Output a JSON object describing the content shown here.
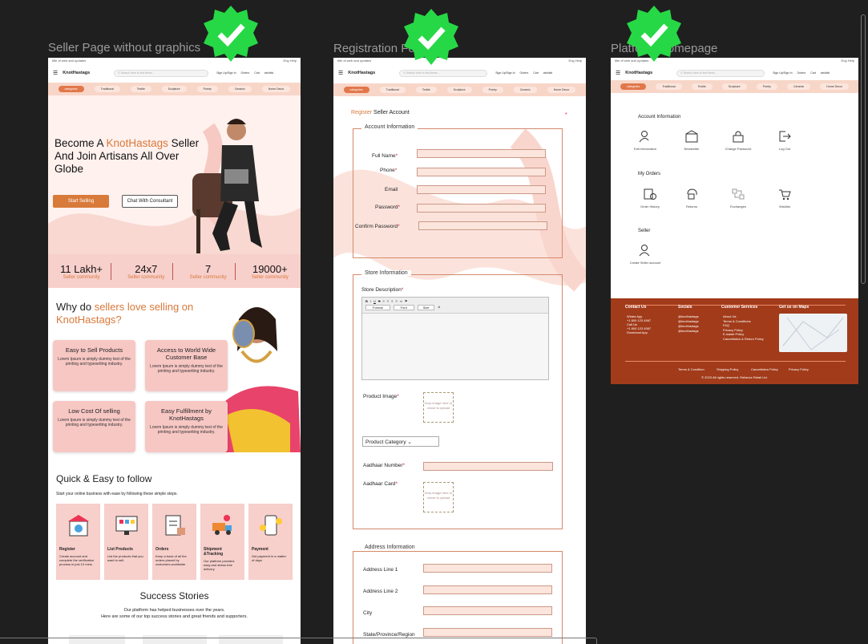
{
  "frames": {
    "seller": {
      "label": "Seller Page without graphics"
    },
    "registration": {
      "label": "Registration Form"
    },
    "platform": {
      "label": "Platform Homepage"
    }
  },
  "common": {
    "topbar_left": "title of web and updates",
    "topbar_right": "Eng  Help",
    "logo": "KnotHastags",
    "search_placeholder": "Search here to find items...",
    "links": [
      "Sign Up/Sign In",
      "Orders",
      "Cart",
      "wishlist"
    ],
    "categories": [
      "categories",
      "Traditional",
      "Textile",
      "Sculpture",
      "Poetry",
      "Ceramic",
      "Home Decor"
    ]
  },
  "seller": {
    "hero_line1_a": "Become A ",
    "hero_line1_b": "KnotHastags",
    "hero_line1_c": " Seller",
    "hero_line2": "And Join Artisans All Over",
    "hero_line3": "Globe",
    "start_btn": "Start Selling",
    "consult_btn": "Chat With Consultant",
    "stats": [
      {
        "n": "11 Lakh+",
        "l": "Seller community"
      },
      {
        "n": "24x7",
        "l": "Seller community"
      },
      {
        "n": "7",
        "l": "Seller community"
      },
      {
        "n": "19000+",
        "l": "Seller community"
      }
    ],
    "why_a": "Why  do ",
    "why_b": "sellers love selling on",
    "why_c": "KnotHastags?",
    "cards": [
      {
        "t": "Easy  to Sell Products",
        "d": "Lorem Ipsum is simply dummy text of the printing and typesetting industry."
      },
      {
        "t": "Access to World Wide Customer Base",
        "d": "Lorem Ipsum is simply dummy text of the printing and typesetting industry."
      },
      {
        "t": "Low Cost Of selling",
        "d": "Lorem Ipsum is simply dummy text of the printing and typesetting industry."
      },
      {
        "t": "Easy Fulfillment by KnotHastags",
        "d": "Lorem Ipsum is simply dummy text of the printing and typesetting industry."
      }
    ],
    "quick_title": "Quick & Easy to follow",
    "quick_sub": "Start your online business with ease by following these simple steps.",
    "steps": [
      {
        "t": "Register",
        "d": "Create account and complete the verification process in just 10 mins."
      },
      {
        "t": "List Products",
        "d": "List the products that you want to sell."
      },
      {
        "t": "Orders",
        "d": "Keep a track of all the orders placed by customers worldwide"
      },
      {
        "t": "Shipment &Tracking",
        "d": "Our platform provides easy and stress free delivery"
      },
      {
        "t": "Payment",
        "d": "Get payment in a matter of days"
      }
    ],
    "success_title": "Success Stories",
    "success_sub1": "Our platform has helped businesses over the years.",
    "success_sub2": "Here are some of our top success stories and great friends and supporters."
  },
  "registration": {
    "title_a": "Register",
    "title_b": " Seller Account",
    "account_legend": "Account Information",
    "fields": [
      "Full Name",
      "Phone",
      "Email",
      "Password",
      "Confirm Password"
    ],
    "store_legend": "Store Information",
    "store_desc": "Store Description",
    "rte_format": "Format",
    "rte_font": "Font",
    "rte_size": "Size",
    "product_image": "Product Image",
    "drop_text": "Drop image here or chose to upload",
    "product_category": "Product Category",
    "aadhaar_number": "Aadhaar Number",
    "aadhaar_card": "Aadhaar Card",
    "address_legend": "Address Information",
    "address_fields": [
      "Address Line 1",
      "Address Line 2",
      "City",
      "State/Province/Region"
    ]
  },
  "platform": {
    "account_title": "Account Information",
    "account_items": [
      "Edit Information",
      "Newsletter",
      "Change Password",
      "Log Out"
    ],
    "orders_title": "My Orders",
    "orders_items": [
      "Order History",
      "Returns",
      "Exchanges",
      "Wishlist"
    ],
    "seller_title": "Seller",
    "seller_item": "Create Seller account",
    "footer_contact": "Contact Us",
    "footer_contact_items": [
      "Whats App",
      "+1 800 123 4567",
      "Call Us",
      "+1 800 123 4567",
      "Download App"
    ],
    "footer_socials": "Socials",
    "footer_social_items": [
      "@knothastags",
      "@knothastags",
      "@knothastags",
      "@knothastags"
    ],
    "footer_services": "Customer Services",
    "footer_service_items": [
      "About Us",
      "Terms & Conditions",
      "FAQ",
      "Privacy Policy",
      "E-waste Policy",
      "Cancellation & Return Policy"
    ],
    "footer_map": "Get us on Maps",
    "footer_links": [
      "Terms & Condition",
      "Shipping Policy",
      "Cancellation Policy",
      "Privacy Policy"
    ],
    "copyright": "© 2023 All rights reserved. Reliance Retail Ltd."
  },
  "colors": {
    "accent": "#d9793a",
    "pink": "#f7cfcb",
    "footer": "#a23b1a",
    "check": "#27d846"
  }
}
